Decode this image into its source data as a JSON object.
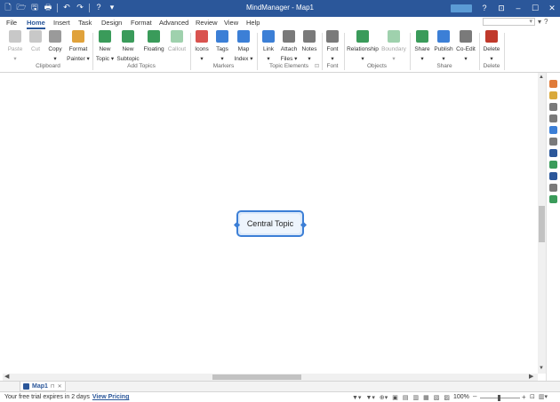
{
  "window": {
    "title": "MindManager - Map1",
    "qat": [
      "🗋",
      "🗁",
      "🖫",
      "🖶",
      "↶",
      "↷",
      "?",
      "▾"
    ],
    "controls": [
      "?",
      "⊡",
      "–",
      "☐",
      "✕"
    ]
  },
  "tabs": [
    "File",
    "Home",
    "Insert",
    "Task",
    "Design",
    "Format",
    "Advanced",
    "Review",
    "View",
    "Help"
  ],
  "active_tab": "Home",
  "search": {
    "placeholder": "",
    "dropdown_glyph": "▾"
  },
  "top_right_glyphs": [
    "▾",
    "?"
  ],
  "ribbon": {
    "buttons": [
      {
        "id": "paste",
        "label": "Paste",
        "sub": "▾",
        "color": "#c8c8c8",
        "disabled": true
      },
      {
        "id": "cut",
        "label": "Cut",
        "sub": "",
        "color": "#c8c8c8",
        "disabled": true
      },
      {
        "id": "copy",
        "label": "Copy",
        "sub": "▾",
        "color": "#9a9a9a",
        "disabled": false
      },
      {
        "id": "format-painter",
        "label": "Format",
        "sub": "Painter ▾",
        "color": "#e0a23b",
        "disabled": false
      },
      {
        "id": "new-topic",
        "label": "New",
        "sub": "Topic ▾",
        "color": "#3a9b5a",
        "disabled": false
      },
      {
        "id": "new-subtopic",
        "label": "New",
        "sub": "Subtopic",
        "color": "#3a9b5a",
        "disabled": false
      },
      {
        "id": "floating",
        "label": "Floating",
        "sub": "",
        "color": "#3a9b5a",
        "disabled": false
      },
      {
        "id": "callout",
        "label": "Callout",
        "sub": "",
        "color": "#9fd1ad",
        "disabled": true
      },
      {
        "id": "icons",
        "label": "Icons",
        "sub": "▾",
        "color": "#d9534f",
        "disabled": false
      },
      {
        "id": "tags",
        "label": "Tags",
        "sub": "▾",
        "color": "#3c7fd6",
        "disabled": false
      },
      {
        "id": "map-index",
        "label": "Map",
        "sub": "Index ▾",
        "color": "#3c7fd6",
        "disabled": false
      },
      {
        "id": "link",
        "label": "Link",
        "sub": "▾",
        "color": "#3c7fd6",
        "disabled": false
      },
      {
        "id": "attach-files",
        "label": "Attach",
        "sub": "Files ▾",
        "color": "#7a7a7a",
        "disabled": false
      },
      {
        "id": "notes",
        "label": "Notes",
        "sub": "▾",
        "color": "#7a7a7a",
        "disabled": false
      },
      {
        "id": "font",
        "label": "Font",
        "sub": "▾",
        "color": "#7a7a7a",
        "disabled": false
      },
      {
        "id": "relationship",
        "label": "Relationship",
        "sub": "▾",
        "color": "#3a9b5a",
        "disabled": false
      },
      {
        "id": "boundary",
        "label": "Boundary",
        "sub": "▾",
        "color": "#9fd1ad",
        "disabled": true
      },
      {
        "id": "share",
        "label": "Share",
        "sub": "▾",
        "color": "#3a9b5a",
        "disabled": false
      },
      {
        "id": "publish",
        "label": "Publish",
        "sub": "▾",
        "color": "#3c7fd6",
        "disabled": false
      },
      {
        "id": "co-edit",
        "label": "Co-Edit",
        "sub": "▾",
        "color": "#7a7a7a",
        "disabled": false
      },
      {
        "id": "delete",
        "label": "Delete",
        "sub": "▾",
        "color": "#c0392b",
        "disabled": false
      }
    ],
    "groups": [
      "Clipboard",
      "Add Topics",
      "Markers",
      "Topic Elements",
      "Font",
      "Objects",
      "Share",
      "Delete"
    ],
    "topic_elements_launcher": "⊡"
  },
  "canvas": {
    "central_topic": "Central Topic"
  },
  "scroll": {
    "up": "▲",
    "down": "▼",
    "left": "◀",
    "right": "▶"
  },
  "sidebar_colors": [
    "#e07b39",
    "#d9a93b",
    "#7a7a7a",
    "#7a7a7a",
    "#3c7fd6",
    "#7a7a7a",
    "#2b579a",
    "#3a9b5a",
    "#2b579a",
    "#7a7a7a",
    "#3a9b5a"
  ],
  "document_tab": {
    "name": "Map1",
    "pin": "⊓",
    "close": "✕"
  },
  "status": {
    "trial_text": "Your free trial expires in 2 days",
    "trial_link": "View Pricing",
    "tool_glyphs": [
      "▼▾",
      "▼▾",
      "⊕▾",
      "▣",
      "▤",
      "▥",
      "▦",
      "▧",
      "▨"
    ],
    "zoom": "100%",
    "zoom_minus": "–",
    "zoom_plus": "+",
    "end_glyphs": [
      "⊡",
      "▥▾"
    ]
  }
}
